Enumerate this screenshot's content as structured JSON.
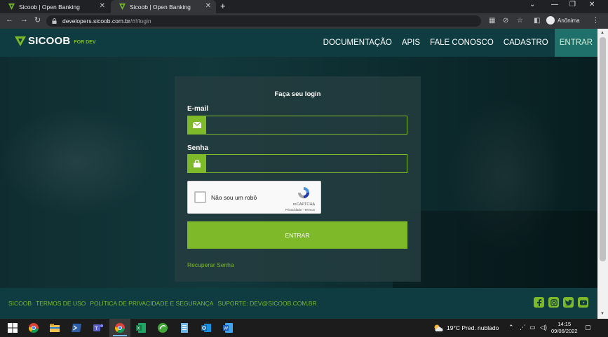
{
  "browser": {
    "tabs": [
      {
        "title": "Sicoob | Open Banking",
        "active": false
      },
      {
        "title": "Sicoob | Open Banking",
        "active": true
      }
    ],
    "url_host": "developers.sicoob.com.br",
    "url_path": "/#!/login",
    "profile_label": "Anônima"
  },
  "header": {
    "logo_text": "SICOOB",
    "logo_sub": "FOR DEV",
    "menu": [
      "DOCUMENTAÇÃO",
      "APIS",
      "FALE CONOSCO",
      "CADASTRO",
      "ENTRAR"
    ]
  },
  "login": {
    "title": "Faça seu login",
    "email_label": "E-mail",
    "email_value": "",
    "password_label": "Senha",
    "password_value": "",
    "captcha_text": "Não sou um robô",
    "captcha_brand": "reCAPTCHA",
    "captcha_terms": "Privacidade - Termos",
    "submit_label": "ENTRAR",
    "recover_label": "Recuperar Senha"
  },
  "footer": {
    "links": [
      "SICOOB",
      "TERMOS DE USO",
      "POLÍTICA DE PRIVACIDADE E SEGURANÇA",
      "SUPORTE: DEV@SICOOB.COM.BR"
    ],
    "social_icons": [
      "facebook-icon",
      "instagram-icon",
      "twitter-icon",
      "youtube-icon"
    ]
  },
  "taskbar": {
    "weather_temp": "19°C",
    "weather_desc": "Pred. nublado",
    "time": "14:15",
    "date": "09/06/2022"
  },
  "colors": {
    "brand_green": "#7db928",
    "header_teal": "#0e3c40",
    "active_menu": "#1f6f6a"
  }
}
